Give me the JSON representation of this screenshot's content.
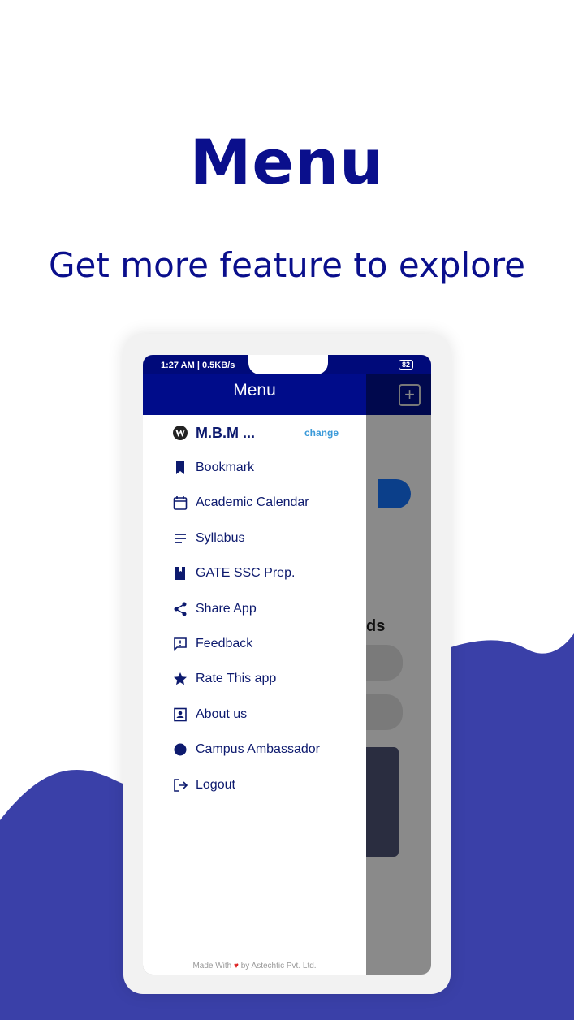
{
  "promo": {
    "title": "Menu",
    "subtitle": "Get more feature to explore"
  },
  "status": {
    "time": "1:27 AM | 0.5KB/s",
    "battery": "82"
  },
  "drawer": {
    "title": "Menu",
    "college": "M.B.M ...",
    "change": "change",
    "items": [
      {
        "label": "Bookmark",
        "icon": "bookmark-icon"
      },
      {
        "label": "Academic Calendar",
        "icon": "calendar-icon"
      },
      {
        "label": "Syllabus",
        "icon": "lines-icon"
      },
      {
        "label": "GATE SSC Prep.",
        "icon": "book-icon"
      },
      {
        "label": "Share App",
        "icon": "share-icon"
      },
      {
        "label": "Feedback",
        "icon": "feedback-icon"
      },
      {
        "label": "Rate This app",
        "icon": "star-icon"
      },
      {
        "label": "About us",
        "icon": "contact-icon"
      },
      {
        "label": "Campus Ambassador",
        "icon": "circle-icon"
      },
      {
        "label": "Logout",
        "icon": "logout-icon"
      }
    ],
    "footer_pre": "Made With",
    "footer_post": "by Astechtic Pvt. Ltd."
  },
  "background": {
    "behind_text": "ds"
  },
  "colors": {
    "navy": "#000c8a",
    "wave": "#3a40a8",
    "text": "#0d1a6e",
    "link": "#3b9ad9"
  }
}
